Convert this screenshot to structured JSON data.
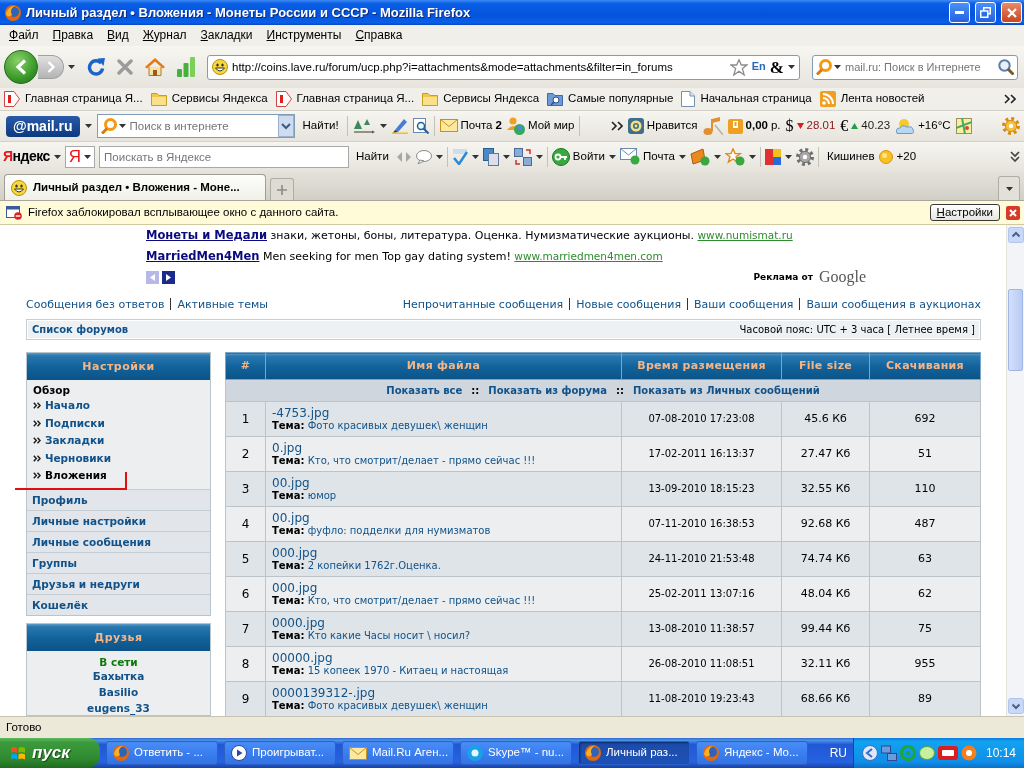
{
  "window": {
    "title": "Личный раздел • Вложения - Монеты России и СССР - Mozilla Firefox"
  },
  "menu": [
    "Файл",
    "Правка",
    "Вид",
    "Журнал",
    "Закладки",
    "Инструменты",
    "Справка"
  ],
  "navigation": {
    "url": "http://coins.lave.ru/forum/ucp.php?i=attachments&mode=attachments&filter=in_forums",
    "url_badges": [
      "En",
      "&"
    ],
    "search_placeholder": "mail.ru: Поиск в Интернете"
  },
  "bookmarks": [
    {
      "kind": "yandex",
      "label": "Главная страница Я..."
    },
    {
      "kind": "folder",
      "label": "Сервисы Яндекса"
    },
    {
      "kind": "yandex",
      "label": "Главная страница Я..."
    },
    {
      "kind": "folder",
      "label": "Сервисы Яндекса"
    },
    {
      "kind": "smart-folder",
      "label": "Самые популярные"
    },
    {
      "kind": "page",
      "label": "Начальная страница"
    },
    {
      "kind": "feed",
      "label": "Лента новостей"
    }
  ],
  "mailru_toolbar": {
    "logo": "@mail.ru",
    "search_placeholder": "Поиск в интернете",
    "search_button": "Найти!",
    "mail": {
      "label": "Почта",
      "count": "2"
    },
    "world": "Мой мир",
    "like": "Нравится",
    "balance": {
      "amount": "0,00",
      "unit": "р."
    },
    "rates": [
      {
        "symbol": "$",
        "rising": false,
        "value": "28.01"
      },
      {
        "symbol": "€",
        "rising": true,
        "value": "40.23"
      }
    ],
    "weather": "+16°C"
  },
  "yandex_toolbar": {
    "logo": "Яндекс",
    "logo_button": "Я",
    "search_placeholder": "Поискать в Яндексе",
    "search_button": "Найти",
    "login": "Войти",
    "mail": "Почта",
    "city": "Кишинев",
    "weather": "+20"
  },
  "tabs": [
    {
      "label": "Личный раздел • Вложения - Моне...",
      "selected": true
    }
  ],
  "notification": {
    "text": "Firefox заблокировал всплывающее окно с данного сайта.",
    "button": "Настройки"
  },
  "ads": [
    {
      "title": "Монеты и Медали",
      "text": "знаки, жетоны, боны, литература. Оценка. Нумизматические аукционы.",
      "url": "www.numismat.ru"
    },
    {
      "title": "MarriedMen4Men",
      "text": "Men seeking for men Top gay dating system!",
      "url": "www.marriedmen4men.com"
    }
  ],
  "ads_label": {
    "text": "Реклама от",
    "brand": "Google"
  },
  "quick_links": {
    "left": [
      "Сообщения без ответов",
      "Активные темы"
    ],
    "right": [
      "Непрочитанные сообщения",
      "Новые сообщения",
      "Ваши сообщения",
      "Ваши сообщения в аукционах"
    ]
  },
  "breadcrumb": {
    "forum_list": "Список форумов",
    "timezone": "Часовой пояс: UTC + 3 часа [ Летнее время ]"
  },
  "sidebar": {
    "title": "Настройки",
    "section": "Обзор",
    "items": [
      {
        "label": "Начало",
        "selected": false
      },
      {
        "label": "Подписки",
        "selected": false
      },
      {
        "label": "Закладки",
        "selected": false
      },
      {
        "label": "Черновики",
        "selected": false
      },
      {
        "label": "Вложения",
        "selected": true
      }
    ],
    "links": [
      "Профиль",
      "Личные настройки",
      "Личные сообщения",
      "Группы",
      "Друзья и недруги",
      "Кошелёк"
    ]
  },
  "friends": {
    "title": "Друзья",
    "status": "В сети",
    "names": [
      "Бахытка",
      "Basilio",
      "eugens_33"
    ]
  },
  "table": {
    "columns": [
      "#",
      "Имя файла",
      "Время размещения",
      "File size",
      "Скачивания"
    ],
    "filters": [
      {
        "kind": "link",
        "text": "Показать все"
      },
      {
        "kind": "separator",
        "text": "::"
      },
      {
        "kind": "link",
        "text": "Показать из форума"
      },
      {
        "kind": "separator",
        "text": "::"
      },
      {
        "kind": "link",
        "text": "Показать из Личных сообщений"
      }
    ],
    "rows": [
      {
        "num": "1",
        "file": "-4753.jpg",
        "topic_label": "Тема:",
        "topic": "Фото красивых девушек\\ женщин",
        "time": "07-08-2010 17:23:08",
        "size": "45.6 Кб",
        "downloads": "692"
      },
      {
        "num": "2",
        "file": "0.jpg",
        "topic_label": "Тема:",
        "topic": "Кто, что смотрит/делает - прямо сейчас !!!",
        "time": "17-02-2011 16:13:37",
        "size": "27.47 Кб",
        "downloads": "51"
      },
      {
        "num": "3",
        "file": "00.jpg",
        "topic_label": "Тема:",
        "topic": "юмор",
        "time": "13-09-2010 18:15:23",
        "size": "32.55 Кб",
        "downloads": "110"
      },
      {
        "num": "4",
        "file": "00.jpg",
        "topic_label": "Тема:",
        "topic": "фуфло: подделки для нумизматов",
        "time": "07-11-2010 16:38:53",
        "size": "92.68 Кб",
        "downloads": "487"
      },
      {
        "num": "5",
        "file": "000.jpg",
        "topic_label": "Тема:",
        "topic": "2 копейки 1762г.Оценка.",
        "time": "24-11-2010 21:53:48",
        "size": "74.74 Кб",
        "downloads": "63"
      },
      {
        "num": "6",
        "file": "000.jpg",
        "topic_label": "Тема:",
        "topic": "Кто, что смотрит/делает - прямо сейчас !!!",
        "time": "25-02-2011 13:07:16",
        "size": "48.04 Кб",
        "downloads": "62"
      },
      {
        "num": "7",
        "file": "0000.jpg",
        "topic_label": "Тема:",
        "topic": "Кто какие Часы носит \\ носил?",
        "time": "13-08-2010 11:38:57",
        "size": "99.44 Кб",
        "downloads": "75"
      },
      {
        "num": "8",
        "file": "00000.jpg",
        "topic_label": "Тема:",
        "topic": "15 копеек 1970 - Китаец и настоящая",
        "time": "26-08-2010 11:08:51",
        "size": "32.11 Кб",
        "downloads": "955"
      },
      {
        "num": "9",
        "file": "0000139312-.jpg",
        "topic_label": "Тема:",
        "topic": "Фото красивых девушек\\ женщин",
        "time": "11-08-2010 19:23:43",
        "size": "68.66 Кб",
        "downloads": "89"
      }
    ]
  },
  "status_bar": {
    "text": "Готово"
  },
  "taskbar": {
    "start": "пуск",
    "tasks": [
      {
        "kind": "browser",
        "label": "Ответить - ...",
        "selected": false
      },
      {
        "kind": "player",
        "label": "Проигрыват...",
        "selected": false
      },
      {
        "kind": "mail",
        "label": "Mail.Ru Аген...",
        "selected": false
      },
      {
        "kind": "chat",
        "label": "Skype™ - nu...",
        "selected": false
      },
      {
        "kind": "browser",
        "label": "Личный раз...",
        "selected": true
      },
      {
        "kind": "browser",
        "label": "Яндекс - Мо...",
        "selected": false
      }
    ],
    "language": "RU",
    "clock": "10:14"
  }
}
